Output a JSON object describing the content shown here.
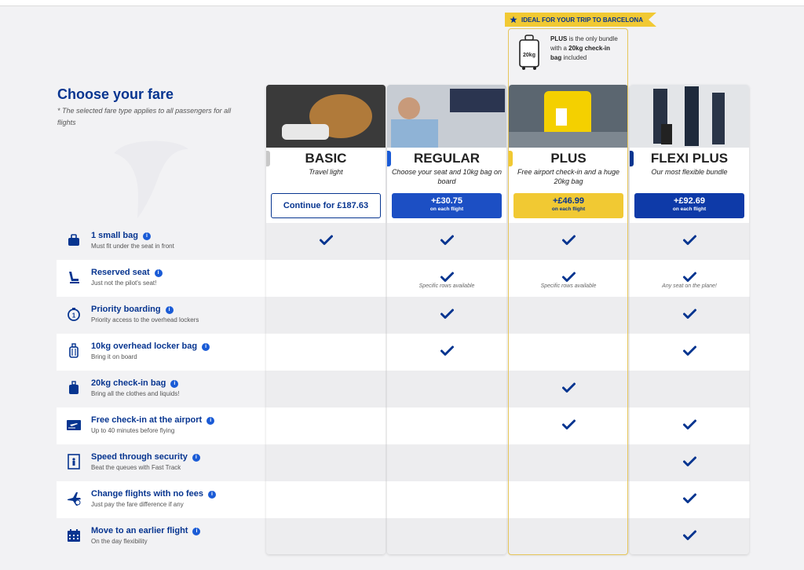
{
  "page": {
    "heading": "Choose your fare",
    "subnote": "* The selected fare type applies to all passengers for all flights"
  },
  "banner": {
    "label": "IDEAL FOR YOUR TRIP TO BARCELONA",
    "promo_prefix": "PLUS",
    "promo_middle": " is the only bundle with a ",
    "promo_bold": "20kg check-in bag",
    "promo_suffix": " included",
    "bag_label": "20kg"
  },
  "features": [
    {
      "title": "1 small bag",
      "desc": "Must fit under the seat in front",
      "icon": "small-bag-icon"
    },
    {
      "title": "Reserved seat",
      "desc": "Just not the pilot's seat!",
      "icon": "seat-icon"
    },
    {
      "title": "Priority boarding",
      "desc": "Priority access to the overhead lockers",
      "icon": "priority-icon"
    },
    {
      "title": "10kg overhead locker bag",
      "desc": "Bring it on board",
      "icon": "cabin-bag-icon"
    },
    {
      "title": "20kg check-in bag",
      "desc": "Bring all the clothes and liquids!",
      "icon": "checkin-bag-icon"
    },
    {
      "title": "Free check-in at the airport",
      "desc": "Up to 40 minutes before flying",
      "icon": "boarding-pass-icon"
    },
    {
      "title": "Speed through security",
      "desc": "Beat the queues with Fast Track",
      "icon": "security-icon"
    },
    {
      "title": "Change flights with no fees",
      "desc": "Just pay the fare difference if any",
      "icon": "plane-change-icon"
    },
    {
      "title": "Move to an earlier flight",
      "desc": "On the day flexibility",
      "icon": "calendar-icon"
    }
  ],
  "fares": [
    {
      "name": "BASIC",
      "tagline": "Travel light",
      "button": "Continue for £187.63",
      "button_sub": "",
      "marker": "#c8c8c8",
      "checks": [
        true,
        false,
        false,
        false,
        false,
        false,
        false,
        false,
        false
      ],
      "notes": [
        "",
        "",
        "",
        "",
        "",
        "",
        "",
        "",
        ""
      ]
    },
    {
      "name": "REGULAR",
      "tagline": "Choose your seat and 10kg bag on board",
      "button": "+£30.75",
      "button_sub": "on each flight",
      "marker": "#1a5bd6",
      "button_color": "#1c4fc4",
      "checks": [
        true,
        true,
        true,
        true,
        false,
        false,
        false,
        false,
        false
      ],
      "notes": [
        "",
        "Specific rows available",
        "",
        "",
        "",
        "",
        "",
        "",
        ""
      ]
    },
    {
      "name": "PLUS",
      "tagline": "Free airport check-in and a huge 20kg bag",
      "button": "+£46.99",
      "button_sub": "on each flight",
      "marker": "#f1c933",
      "button_color": "#f1c933",
      "checks": [
        true,
        true,
        false,
        false,
        true,
        true,
        false,
        false,
        false
      ],
      "notes": [
        "",
        "Specific rows available",
        "",
        "",
        "",
        "",
        "",
        "",
        ""
      ]
    },
    {
      "name": "FLEXI PLUS",
      "tagline": "Our most flexible bundle",
      "button": "+£92.69",
      "button_sub": "on each flight",
      "marker": "#073590",
      "button_color": "#0e3aa8",
      "checks": [
        true,
        true,
        true,
        true,
        false,
        true,
        true,
        true,
        true
      ],
      "notes": [
        "",
        "Any seat on the plane!",
        "",
        "",
        "",
        "",
        "",
        "",
        ""
      ]
    }
  ],
  "colors": {
    "brand": "#073590",
    "accent_yellow": "#f1c933",
    "check": "#073590"
  }
}
